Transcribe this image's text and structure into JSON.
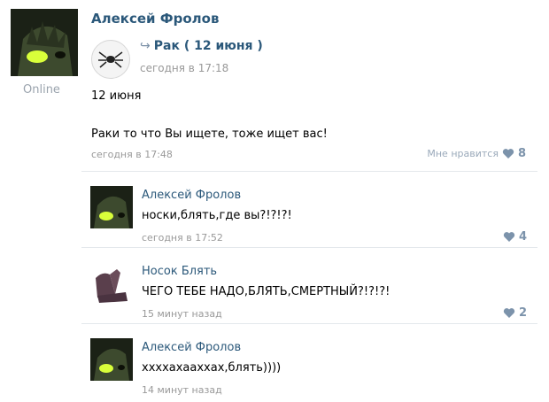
{
  "post": {
    "author": "Алексей Фролов",
    "online": "Online",
    "repost": {
      "share_icon": "share-arrow-icon",
      "title": "Рак ( 12 июня )",
      "date": "сегодня в 17:18"
    },
    "text_line1": "12 июня",
    "text_line2": "Раки то что Вы ищете, тоже ищет вас!",
    "date": "сегодня в 17:48",
    "like_label": "Мне нравится",
    "like_count": "8"
  },
  "comments": [
    {
      "author": "Алексей Фролов",
      "text": "носки,блять,где вы?!?!?!",
      "date": "сегодня в 17:52",
      "likes": "4"
    },
    {
      "author": "Носок Блять",
      "text": "ЧЕГО ТЕБЕ НАДО,БЛЯТЬ,СМЕРТНЫЙ?!?!?!",
      "date": "15 минут назад",
      "likes": "2"
    },
    {
      "author": "Алексей Фролов",
      "text": "ххххахааххах,блять))))",
      "date": "14 минут назад",
      "likes": ""
    }
  ],
  "colors": {
    "link": "#2b587a",
    "muted": "#999999",
    "like": "#7c93ab"
  }
}
